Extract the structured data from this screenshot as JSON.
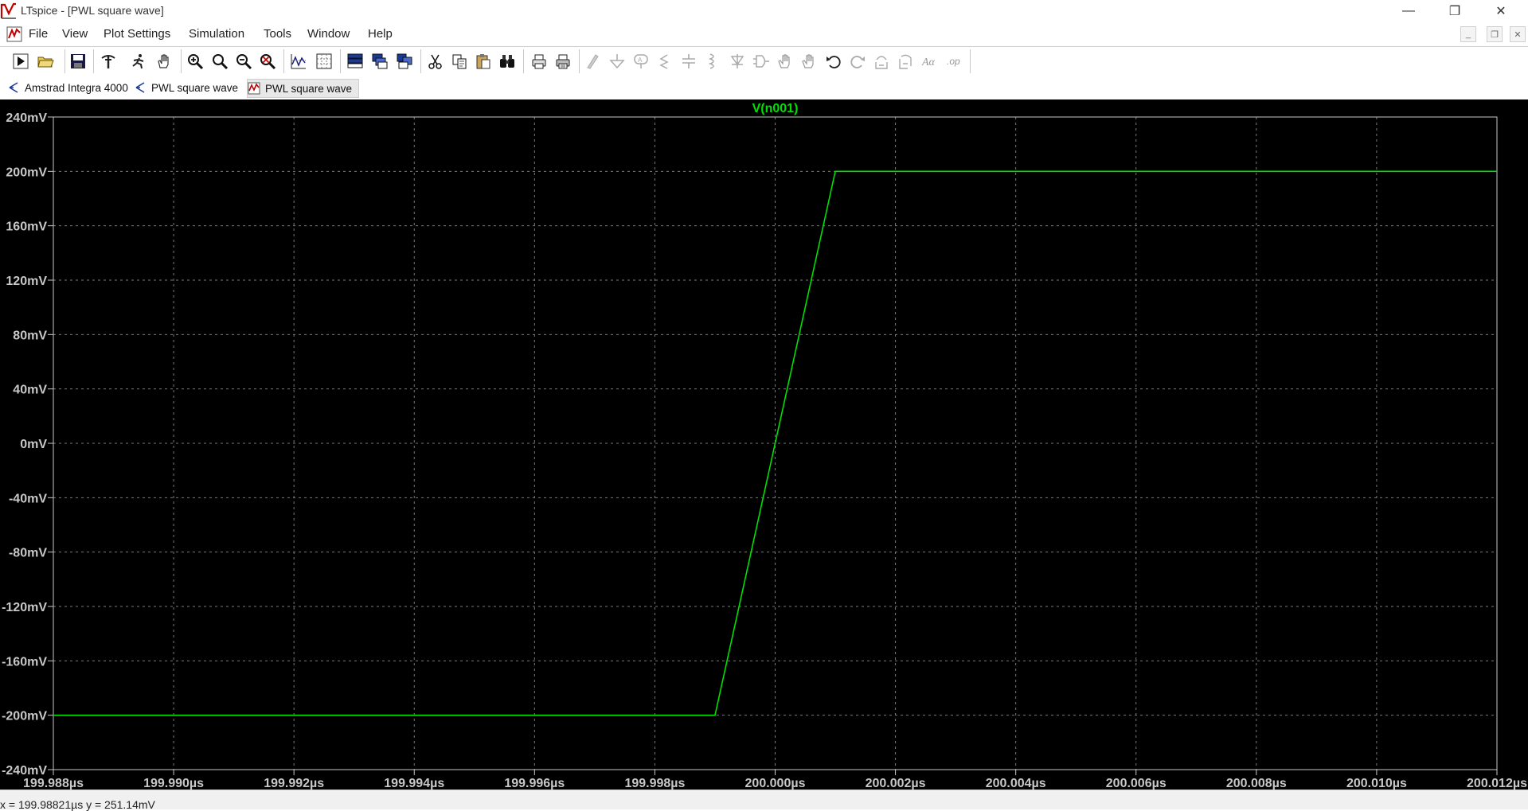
{
  "window": {
    "title": "LTspice - [PWL square wave]",
    "controls": {
      "minimize": "—",
      "maximize": "❐",
      "close": "✕"
    }
  },
  "menu": [
    "File",
    "View",
    "Plot Settings",
    "Simulation",
    "Tools",
    "Window",
    "Help"
  ],
  "mdi_controls": {
    "minimize": "_",
    "restore": "❐",
    "close": "✕"
  },
  "toolbar_icons": [
    "run-icon",
    "open-icon",
    "save-icon",
    "control-panel-icon",
    "halt-icon",
    "pan-hand-icon",
    "zoom-in-icon",
    "zoom-area-icon",
    "zoom-out-icon",
    "zoom-full-icon",
    "autorange-icon",
    "grid-icon",
    "tile-horizontal-icon",
    "cascade-icon",
    "tile-vertical-icon",
    "cut-icon",
    "copy-icon",
    "paste-icon",
    "find-icon",
    "print-preview-icon",
    "print-icon",
    "wire-icon",
    "ground-icon",
    "label-icon",
    "resistor-icon",
    "capacitor-icon",
    "inductor-icon",
    "diode-icon",
    "component-icon",
    "move-icon",
    "drag-icon",
    "undo-icon",
    "redo-icon",
    "rotate-icon",
    "mirror-icon",
    "text-icon",
    "spice-directive-icon"
  ],
  "toolbar_text": {
    "text_icon": "Aα",
    "spice_directive": ".op"
  },
  "tabs": [
    {
      "label": "Amstrad Integra 4000",
      "icon": "schematic-icon"
    },
    {
      "label": "PWL square wave",
      "icon": "schematic-icon"
    },
    {
      "label": "PWL square wave",
      "icon": "waveform-icon",
      "active": true
    }
  ],
  "colors": {
    "background": "#000000",
    "trace": "#00e000",
    "grid": "#7a7a7a",
    "axis_text": "#c8c8c8"
  },
  "chart_data": {
    "type": "line",
    "title": "V(n001)",
    "xlabel": "",
    "ylabel": "",
    "xlim": [
      199.988,
      200.012
    ],
    "ylim": [
      -240,
      240
    ],
    "grid": true,
    "x_ticks": [
      "199.988µs",
      "199.990µs",
      "199.992µs",
      "199.994µs",
      "199.996µs",
      "199.998µs",
      "200.000µs",
      "200.002µs",
      "200.004µs",
      "200.006µs",
      "200.008µs",
      "200.010µs",
      "200.012µs"
    ],
    "y_ticks": [
      "240mV",
      "200mV",
      "160mV",
      "120mV",
      "80mV",
      "40mV",
      "0mV",
      "-40mV",
      "-80mV",
      "-120mV",
      "-160mV",
      "-200mV",
      "-240mV"
    ],
    "series": [
      {
        "name": "V(n001)",
        "color": "#00e000",
        "x": [
          199.988,
          199.999,
          200.001,
          200.012
        ],
        "y": [
          -200,
          -200,
          200,
          200
        ]
      }
    ]
  },
  "status": "x = 199.98821µs    y = 251.14mV"
}
